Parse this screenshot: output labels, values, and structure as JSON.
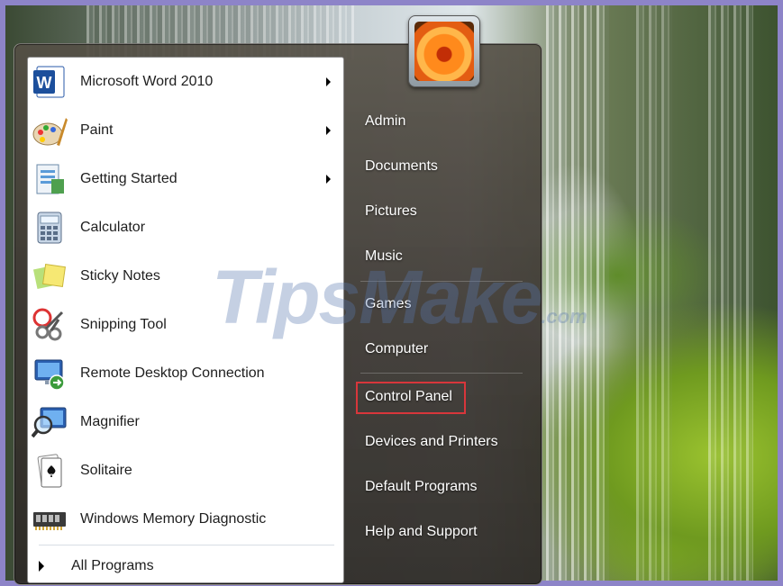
{
  "programs": [
    {
      "label": "Microsoft Word 2010",
      "icon": "word-icon",
      "has_submenu": true
    },
    {
      "label": "Paint",
      "icon": "paint-icon",
      "has_submenu": true
    },
    {
      "label": "Getting Started",
      "icon": "getting-started-icon",
      "has_submenu": true
    },
    {
      "label": "Calculator",
      "icon": "calculator-icon",
      "has_submenu": false
    },
    {
      "label": "Sticky Notes",
      "icon": "sticky-notes-icon",
      "has_submenu": false
    },
    {
      "label": "Snipping Tool",
      "icon": "snipping-tool-icon",
      "has_submenu": false
    },
    {
      "label": "Remote Desktop Connection",
      "icon": "remote-desktop-icon",
      "has_submenu": false
    },
    {
      "label": "Magnifier",
      "icon": "magnifier-icon",
      "has_submenu": false
    },
    {
      "label": "Solitaire",
      "icon": "solitaire-icon",
      "has_submenu": false
    },
    {
      "label": "Windows Memory Diagnostic",
      "icon": "memory-diagnostic-icon",
      "has_submenu": false
    }
  ],
  "all_programs_label": "All Programs",
  "right_items": [
    "Admin",
    "Documents",
    "Pictures",
    "Music",
    "Games",
    "Computer",
    "Control Panel",
    "Devices and Printers",
    "Default Programs",
    "Help and Support"
  ],
  "highlighted_item": "Control Panel",
  "highlight_color": "#d8363b",
  "watermark": {
    "main": "TipsMake",
    "suffix": ".com"
  }
}
